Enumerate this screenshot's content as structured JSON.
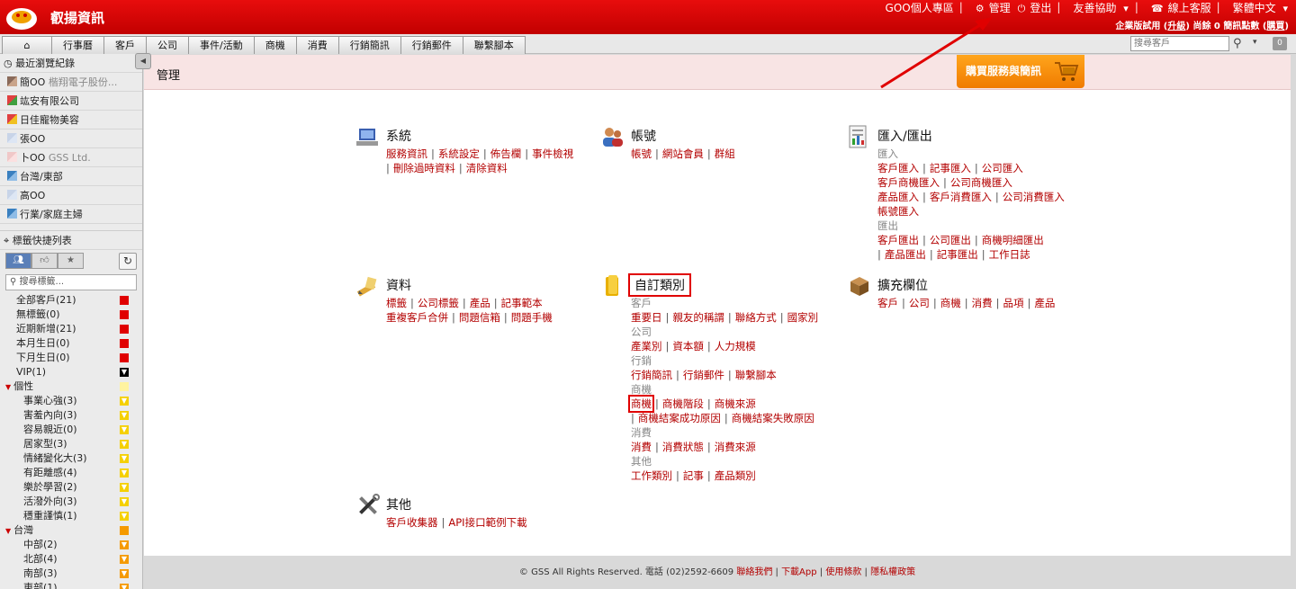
{
  "header": {
    "brand": "叡揚資訊",
    "nav": [
      "GOO個人專區",
      "管理",
      "登出",
      "友善協助",
      "線上客服",
      "繁體中文"
    ],
    "subline_pre": "企業版試用 (",
    "upgrade": "升級",
    "subline_mid": ")  尚餘 0 簡訊點數 (",
    "buy_sms": "購買",
    "subline_post": ")"
  },
  "tabs": [
    "行事曆",
    "客戶",
    "公司",
    "事件/活動",
    "商機",
    "消費",
    "行銷簡訊",
    "行銷郵件",
    "聯繫腳本"
  ],
  "search": {
    "placeholder": "搜尋客戶",
    "badge": "0"
  },
  "sidebar": {
    "recent_title": "最近瀏覽紀錄",
    "recent": [
      {
        "name": "簡OO",
        "extra": "楷翔電子股份..."
      },
      {
        "name": "竑安有限公司",
        "extra": ""
      },
      {
        "name": "日佳寵物美容",
        "extra": ""
      },
      {
        "name": "張OO",
        "extra": ""
      },
      {
        "name": "卜OO",
        "extra": "GSS Ltd."
      },
      {
        "name": "台灣/東部",
        "extra": ""
      },
      {
        "name": "高OO",
        "extra": ""
      },
      {
        "name": "行業/家庭主婦",
        "extra": ""
      }
    ],
    "tags_title": "標籤快捷列表",
    "tag_search_placeholder": "搜尋標籤...",
    "tags": [
      {
        "label": "全部客戶(21)",
        "kind": "top",
        "color": "#e00000"
      },
      {
        "label": "無標籤(0)",
        "kind": "top",
        "color": "#e00000"
      },
      {
        "label": "近期新增(21)",
        "kind": "top",
        "color": "#e00000"
      },
      {
        "label": "本月生日(0)",
        "kind": "top",
        "color": "#e00000"
      },
      {
        "label": "下月生日(0)",
        "kind": "top",
        "color": "#e00000"
      },
      {
        "label": "VIP(1)",
        "kind": "top",
        "color": "#000000"
      },
      {
        "label": "個性",
        "kind": "grp",
        "color": "#fff3a0"
      },
      {
        "label": "事業心強(3)",
        "kind": "sub",
        "color": "#f5d000"
      },
      {
        "label": "害羞內向(3)",
        "kind": "sub",
        "color": "#f5d000"
      },
      {
        "label": "容易親近(0)",
        "kind": "sub",
        "color": "#f5d000"
      },
      {
        "label": "居家型(3)",
        "kind": "sub",
        "color": "#f5d000"
      },
      {
        "label": "情緒變化大(3)",
        "kind": "sub",
        "color": "#f5d000"
      },
      {
        "label": "有距離感(4)",
        "kind": "sub",
        "color": "#f5d000"
      },
      {
        "label": "樂於學習(2)",
        "kind": "sub",
        "color": "#f5d000"
      },
      {
        "label": "活潑外向(3)",
        "kind": "sub",
        "color": "#f5d000"
      },
      {
        "label": "穩重謹慎(1)",
        "kind": "sub",
        "color": "#f5d000"
      },
      {
        "label": "台灣",
        "kind": "grp",
        "color": "#f59a00"
      },
      {
        "label": "中部(2)",
        "kind": "sub",
        "color": "#f59a00"
      },
      {
        "label": "北部(4)",
        "kind": "sub",
        "color": "#f59a00"
      },
      {
        "label": "南部(3)",
        "kind": "sub",
        "color": "#f59a00"
      },
      {
        "label": "東部(1)",
        "kind": "sub",
        "color": "#f59a00"
      }
    ]
  },
  "main": {
    "title": "管理",
    "buy_button": "購買服務與簡訊",
    "sections": {
      "system": {
        "title": "系統",
        "rows": [
          [
            "服務資訊",
            "系統設定",
            "佈告欄",
            "事件檢視"
          ],
          [
            "刪除過時資料",
            "清除資料"
          ]
        ]
      },
      "account": {
        "title": "帳號",
        "rows": [
          [
            "帳號",
            "網站會員",
            "群組"
          ]
        ]
      },
      "io": {
        "title": "匯入/匯出",
        "import_label": "匯入",
        "import_rows": [
          [
            "客戶匯入",
            "記事匯入",
            "公司匯入"
          ],
          [
            "客戶商機匯入",
            "公司商機匯入"
          ],
          [
            "產品匯入",
            "客戶消費匯入",
            "公司消費匯入"
          ],
          [
            "帳號匯入"
          ]
        ],
        "export_label": "匯出",
        "export_rows": [
          [
            "客戶匯出",
            "公司匯出",
            "商機明細匯出"
          ],
          [
            "產品匯出",
            "記事匯出",
            "工作日誌"
          ]
        ]
      },
      "data": {
        "title": "資料",
        "rows": [
          [
            "標籤",
            "公司標籤",
            "產品",
            "記事範本"
          ],
          [
            "重複客戶合併",
            "問題信箱",
            "問題手機"
          ]
        ]
      },
      "custom": {
        "title": "自訂類別",
        "groups": [
          {
            "label": "客戶",
            "rows": [
              [
                "重要日",
                "親友的稱謂",
                "聯絡方式",
                "國家別"
              ]
            ]
          },
          {
            "label": "公司",
            "rows": [
              [
                "產業別",
                "資本額",
                "人力規模"
              ]
            ]
          },
          {
            "label": "行銷",
            "rows": [
              [
                "行銷簡訊",
                "行銷郵件",
                "聯繫腳本"
              ]
            ]
          },
          {
            "label": "商機",
            "rows": [
              [
                "商機",
                "商機階段",
                "商機來源"
              ],
              [
                "商機結案成功原因",
                "商機結案失敗原因"
              ]
            ]
          },
          {
            "label": "消費",
            "rows": [
              [
                "消費",
                "消費狀態",
                "消費來源"
              ]
            ]
          },
          {
            "label": "其他",
            "rows": [
              [
                "工作類別",
                "記事",
                "產品類別"
              ]
            ]
          }
        ]
      },
      "ext": {
        "title": "擴充欄位",
        "rows": [
          [
            "客戶",
            "公司",
            "商機",
            "消費",
            "品項",
            "產品"
          ]
        ]
      },
      "other": {
        "title": "其他",
        "rows": [
          [
            "客戶收集器",
            "API接口範例下載"
          ]
        ]
      }
    }
  },
  "footer": {
    "copyright": "© GSS All Rights Reserved. 電話 (02)2592-6609",
    "links": [
      "聯絡我們",
      "下載App",
      "使用條款",
      "隱私權政策"
    ]
  },
  "colors": {
    "brand_red": "#d40000",
    "link": "#b30000",
    "highlight": "#e00000",
    "buy_orange": "#f59000"
  }
}
